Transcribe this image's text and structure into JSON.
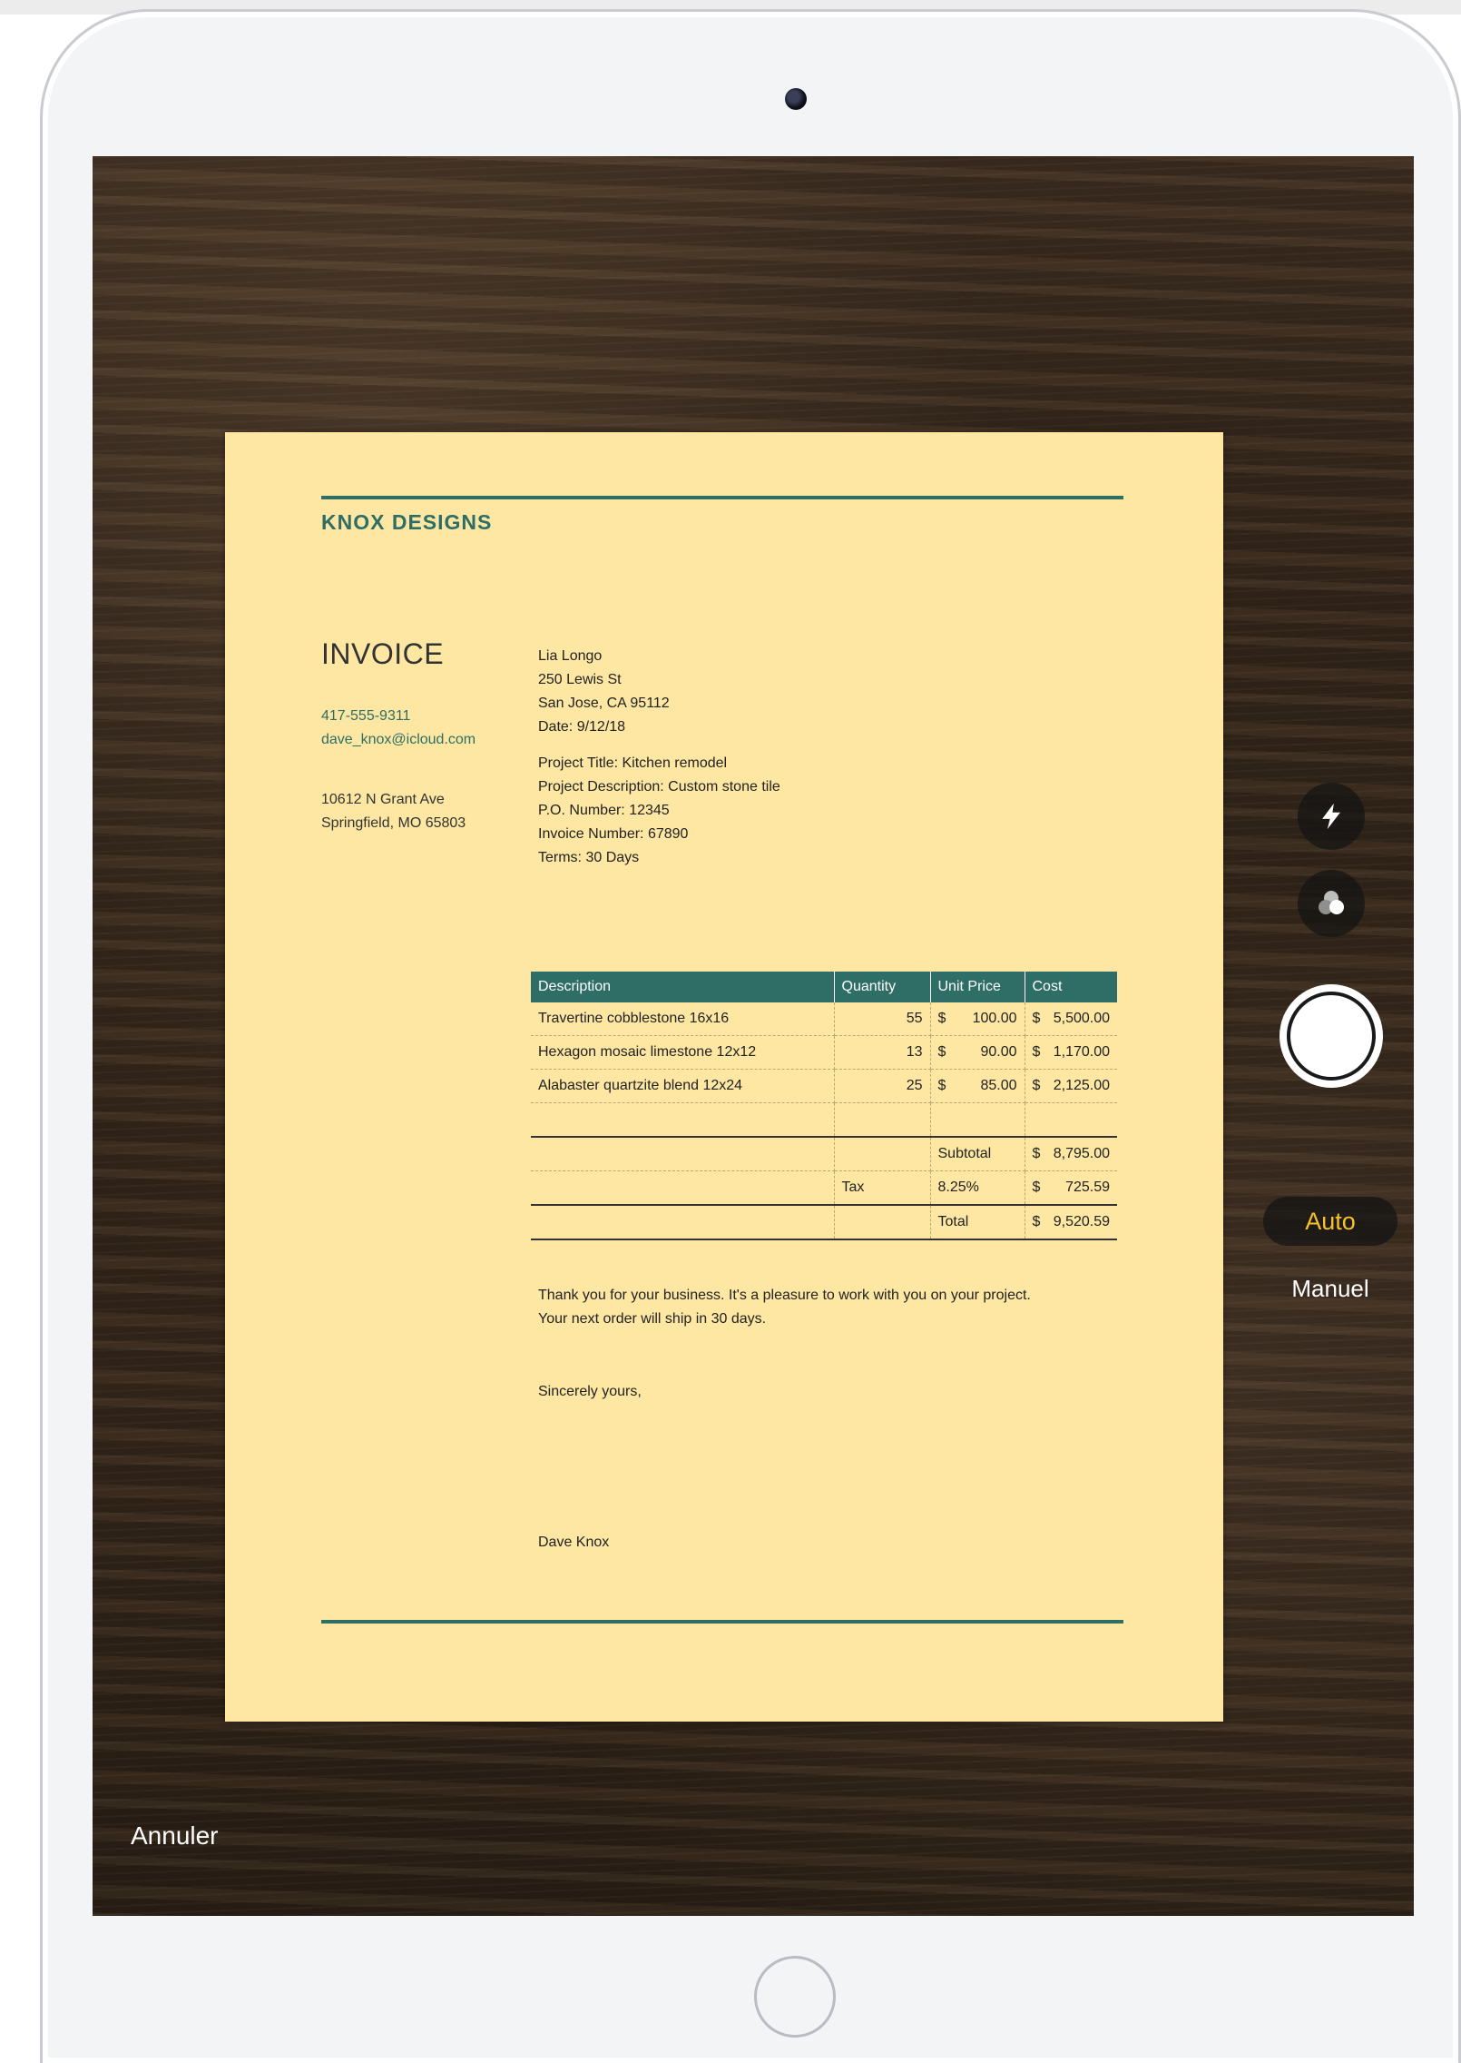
{
  "camera": {
    "cancel_label": "Annuler",
    "mode_auto_label": "Auto",
    "mode_manual_label": "Manuel",
    "flash_icon": "flash-icon",
    "filters_icon": "filters-icon",
    "accent_color": "#f5c12c"
  },
  "document": {
    "company": "KNOX DESIGNS",
    "title": "INVOICE",
    "phone": "417-555-9311",
    "email": "dave_knox@icloud.com",
    "address_line1": "10612 N Grant Ave",
    "address_line2": "Springfield, MO 65803",
    "client": {
      "name": "Lia Longo",
      "street": "250 Lewis St",
      "city": "San Jose, CA 95112",
      "date": "Date: 9/12/18"
    },
    "project": {
      "title": "Project Title: Kitchen remodel",
      "description": "Project Description: Custom stone tile",
      "po": "P.O. Number: 12345",
      "invoice_number": "Invoice Number: 67890",
      "terms": "Terms: 30 Days"
    },
    "table": {
      "headers": [
        "Description",
        "Quantity",
        "Unit Price",
        "Cost"
      ],
      "rows": [
        {
          "description": "Travertine cobblestone 16x16",
          "quantity": "55",
          "unit_cur": "$",
          "unit_price": "100.00",
          "cost_cur": "$",
          "cost": "5,500.00"
        },
        {
          "description": "Hexagon mosaic limestone 12x12",
          "quantity": "13",
          "unit_cur": "$",
          "unit_price": "90.00",
          "cost_cur": "$",
          "cost": "1,170.00"
        },
        {
          "description": "Alabaster quartzite blend 12x24",
          "quantity": "25",
          "unit_cur": "$",
          "unit_price": "85.00",
          "cost_cur": "$",
          "cost": "2,125.00"
        }
      ],
      "subtotal_label": "Subtotal",
      "subtotal_cur": "$",
      "subtotal": "8,795.00",
      "tax_label": "Tax",
      "tax_rate": "8.25%",
      "tax_cur": "$",
      "tax": "725.59",
      "total_label": "Total",
      "total_cur": "$",
      "total": "9,520.59"
    },
    "thanks_line1": "Thank you for your business. It's a pleasure to work with you on your project.",
    "thanks_line2": "Your next order will ship in 30 days.",
    "closing": "Sincerely yours,",
    "signer": "Dave Knox",
    "accent_color": "#2f6e67",
    "paper_color": "#fde7a2"
  }
}
